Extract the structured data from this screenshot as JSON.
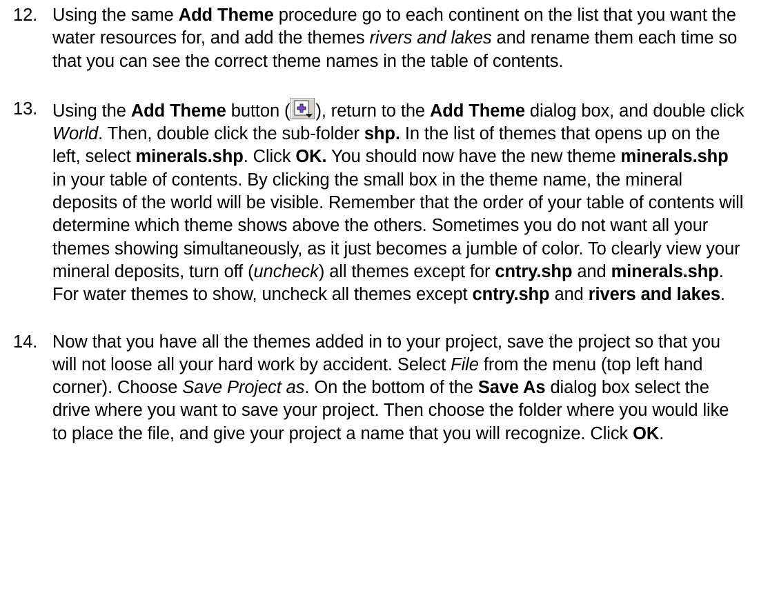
{
  "steps": [
    {
      "number": "12.",
      "t1": "Using the same ",
      "b1": "Add Theme",
      "t2": " procedure go to each continent on the list that you want the water resources for, and add the themes ",
      "i1": "rivers and lakes",
      "t3": " and rename them each time so that you can see the correct theme names in the table of contents."
    },
    {
      "number": "13.",
      "t1": "Using the ",
      "b1": "Add Theme",
      "t2": " button (",
      "icon": "add-theme-icon",
      "t3": "), return to the ",
      "b2": "Add Theme",
      "t4": " dialog box, and double click ",
      "i1": "World",
      "t5": ".  Then, double click the sub-folder ",
      "b3": "shp.",
      "t6": "  In the list of themes that opens up on the left, select ",
      "b4": "minerals.shp",
      "t7": ".  Click ",
      "b5": "OK.",
      "t8": " You should now have the new theme ",
      "b6": "minerals.shp",
      "t9": " in your table of contents. By clicking the small box in the theme name, the mineral deposits of the world will be visible.  Remember that the order of your table of contents will determine which theme shows above the others. Sometimes you do not want all your themes showing simultaneously, as it just becomes a jumble of color.  To clearly view your mineral deposits, turn off (",
      "i2": "uncheck",
      "t10": ") all themes except for ",
      "b7": "cntry.shp",
      "t11": " and  ",
      "b8": "minerals.shp",
      "t12": ".  For water themes to show, uncheck all themes except ",
      "b9": "cntry.shp",
      "t13": " and ",
      "b10": "rivers and lakes",
      "t14": "."
    },
    {
      "number": "14.",
      "t1": "Now that you have all the themes added in to your project, save the project so that you will not loose all your hard work by accident.  Select ",
      "i1": "File",
      "t2": " from the menu (top left hand corner). Choose ",
      "i2": "Save Project as",
      "t3": ".  On the bottom of the ",
      "b1": "Save As",
      "t4": " dialog box select the drive where you want to save your project. Then choose the folder where you would like to place the file, and give your project a name that you will recognize.  Click ",
      "b2": "OK",
      "t5": "."
    }
  ]
}
